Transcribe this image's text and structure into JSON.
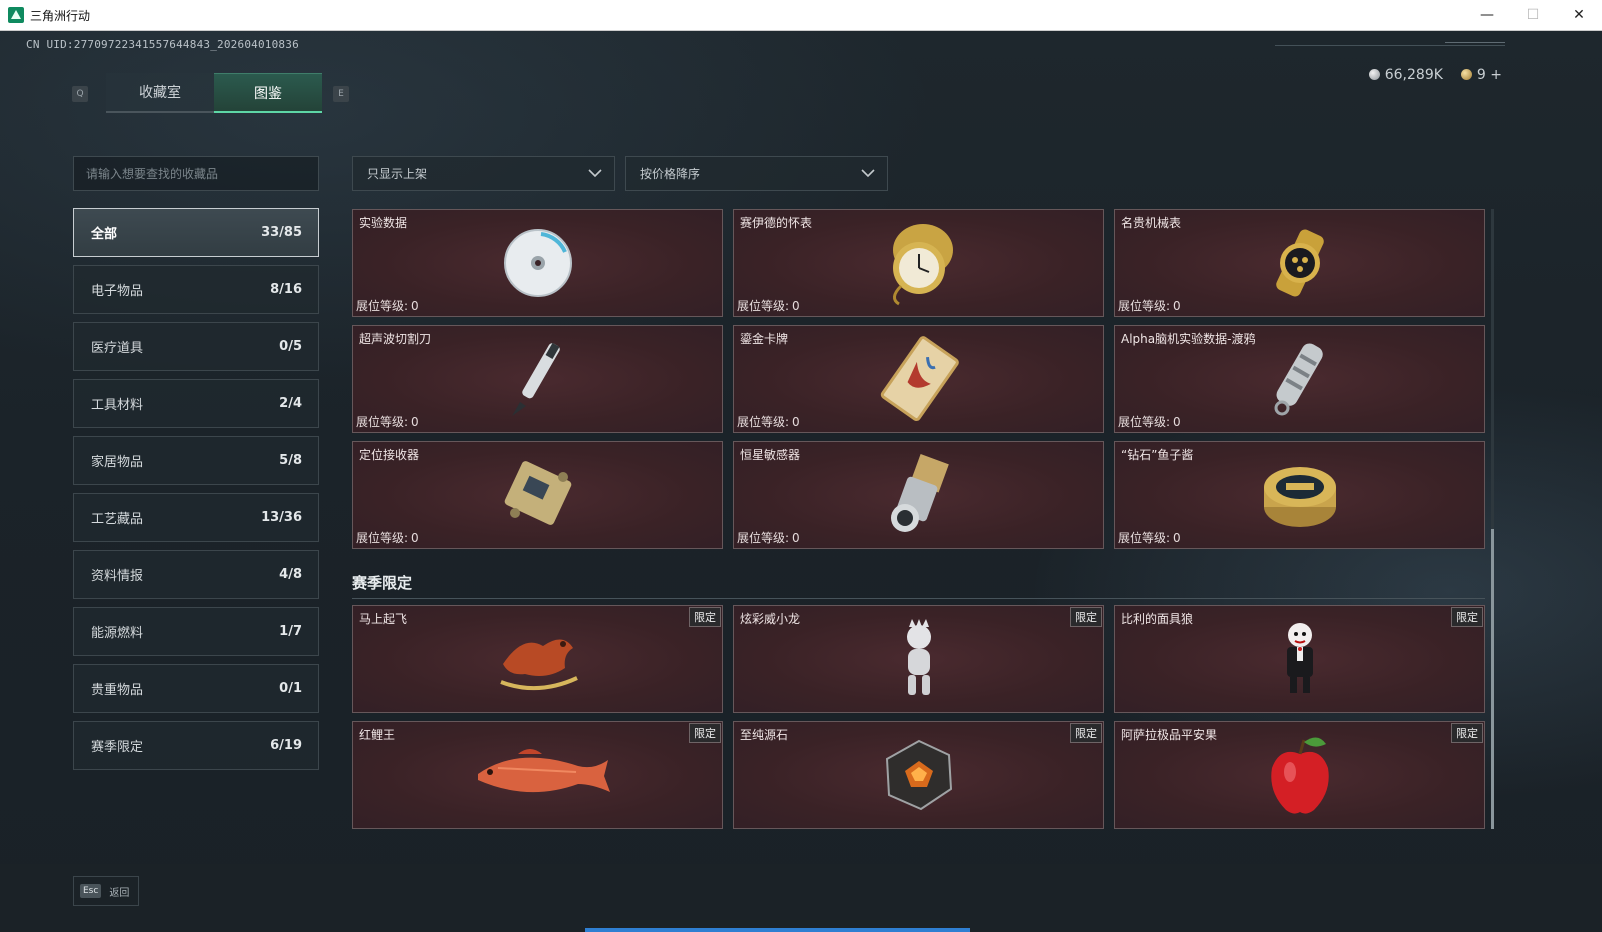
{
  "window": {
    "title": "三角洲行动",
    "minimize": "—",
    "maximize": "☐",
    "close": "✕"
  },
  "uid": "CN UID:27709722341557644843_202604010836",
  "currency": {
    "coins": "66,289K",
    "gold": "9 +"
  },
  "tabs": {
    "key_left": "Q",
    "key_right": "E",
    "items": [
      {
        "label": "收藏室"
      },
      {
        "label": "图鉴"
      }
    ]
  },
  "search": {
    "placeholder": "请输入想要查找的收藏品"
  },
  "filters": {
    "display": "只显示上架",
    "sort": "按价格降序"
  },
  "categories": [
    {
      "label": "全部",
      "count": "33/85"
    },
    {
      "label": "电子物品",
      "count": "8/16"
    },
    {
      "label": "医疗道具",
      "count": "0/5"
    },
    {
      "label": "工具材料",
      "count": "2/4"
    },
    {
      "label": "家居物品",
      "count": "5/8"
    },
    {
      "label": "工艺藏品",
      "count": "13/36"
    },
    {
      "label": "资料情报",
      "count": "4/8"
    },
    {
      "label": "能源燃料",
      "count": "1/7"
    },
    {
      "label": "贵重物品",
      "count": "0/1"
    },
    {
      "label": "赛季限定",
      "count": "6/19"
    }
  ],
  "level_label": "展位等级:",
  "limited_label": "限定",
  "items": [
    {
      "name": "实验数据",
      "level": "0",
      "icon": "disc-icon"
    },
    {
      "name": "赛伊德的怀表",
      "level": "0",
      "icon": "pocket-watch-icon"
    },
    {
      "name": "名贵机械表",
      "level": "0",
      "icon": "wristwatch-icon"
    },
    {
      "name": "超声波切割刀",
      "level": "0",
      "icon": "ultrasonic-cutter-icon"
    },
    {
      "name": "鎏金卡牌",
      "level": "0",
      "icon": "gilded-card-icon"
    },
    {
      "name": "Alpha脑机实验数据-渡鸦",
      "level": "0",
      "icon": "data-capsule-icon"
    },
    {
      "name": "定位接收器",
      "level": "0",
      "icon": "receiver-icon"
    },
    {
      "name": "恒星敏感器",
      "level": "0",
      "icon": "star-sensor-icon"
    },
    {
      "name": "“钻石”鱼子酱",
      "level": "0",
      "icon": "caviar-tin-icon"
    }
  ],
  "season_section": {
    "title": "赛季限定",
    "items": [
      {
        "name": "马上起飞",
        "icon": "rocking-horse-icon"
      },
      {
        "name": "炫彩威小龙",
        "icon": "dragon-figure-icon"
      },
      {
        "name": "比利的面具狼",
        "icon": "puppet-icon"
      },
      {
        "name": "红鲤王",
        "icon": "carp-icon"
      },
      {
        "name": "至纯源石",
        "icon": "source-stone-icon"
      },
      {
        "name": "阿萨拉极品平安果",
        "icon": "apple-icon"
      }
    ]
  },
  "footer": {
    "esc_key": "Esc",
    "esc_label": "返回"
  },
  "colors": {
    "accent": "#5ed6a6",
    "card_bg": "#3a2226",
    "progress": "#2f7fd2"
  }
}
